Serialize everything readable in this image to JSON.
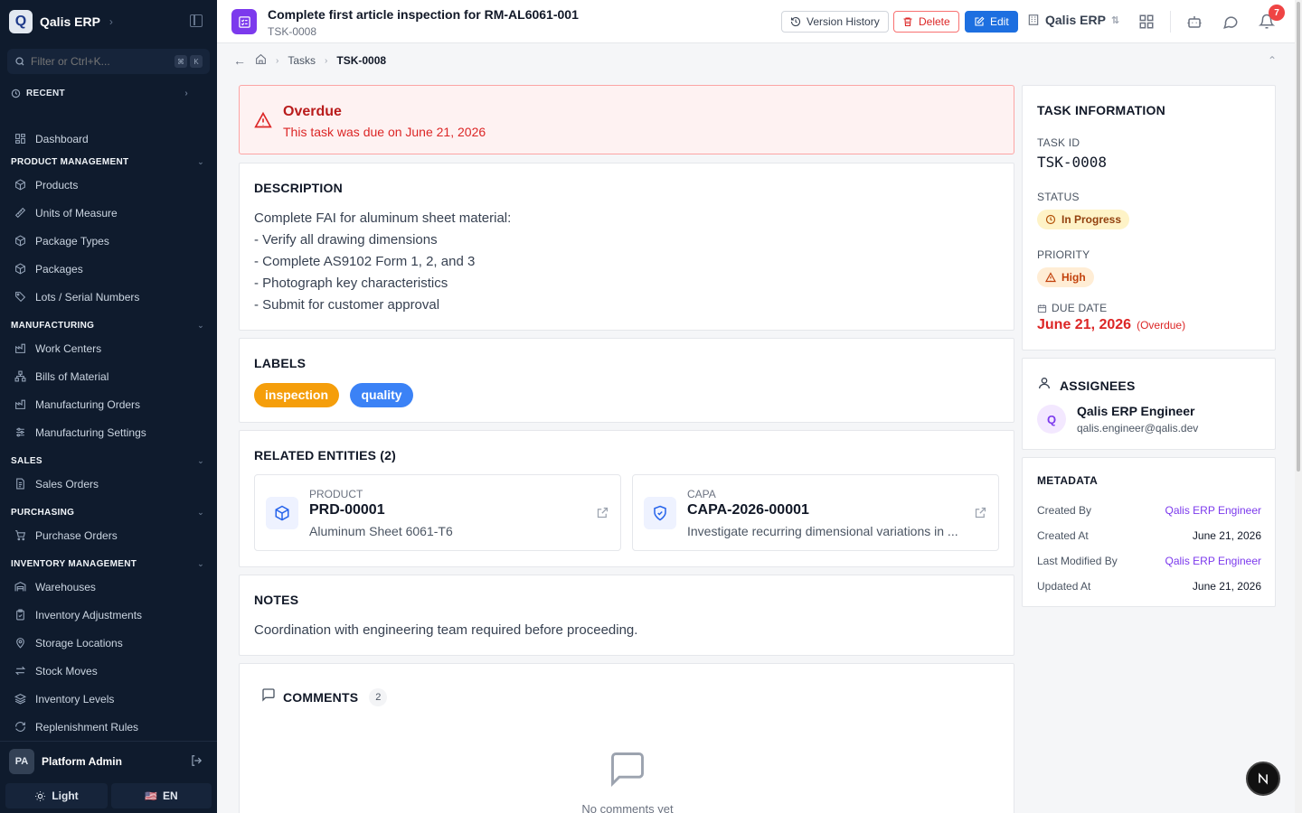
{
  "sidebar": {
    "brand": "Qalis ERP",
    "brand_initial": "Q",
    "filter_placeholder": "Filter or Ctrl+K...",
    "kbd": [
      "⌘",
      "K"
    ],
    "recent_label": "RECENT",
    "top_item": "Dashboard",
    "sections": [
      {
        "title": "PRODUCT MANAGEMENT",
        "items": [
          "Products",
          "Units of Measure",
          "Package Types",
          "Packages",
          "Lots / Serial Numbers"
        ]
      },
      {
        "title": "MANUFACTURING",
        "items": [
          "Work Centers",
          "Bills of Material",
          "Manufacturing Orders",
          "Manufacturing Settings"
        ]
      },
      {
        "title": "SALES",
        "items": [
          "Sales Orders"
        ]
      },
      {
        "title": "PURCHASING",
        "items": [
          "Purchase Orders"
        ]
      },
      {
        "title": "INVENTORY MANAGEMENT",
        "items": [
          "Warehouses",
          "Inventory Adjustments",
          "Storage Locations",
          "Stock Moves",
          "Inventory Levels",
          "Replenishment Rules"
        ]
      }
    ],
    "user": {
      "initials": "PA",
      "name": "Platform Admin"
    },
    "theme_label": "Light",
    "lang_label": "EN",
    "lang_flag": "🇺🇸"
  },
  "header": {
    "title": "Complete first article inspection for RM-AL6061-001",
    "subtitle": "TSK-0008",
    "version_history": "Version History",
    "delete": "Delete",
    "edit": "Edit",
    "tenant": "Qalis ERP",
    "notification_count": "7"
  },
  "breadcrumb": {
    "parent": "Tasks",
    "current": "TSK-0008"
  },
  "alert": {
    "title": "Overdue",
    "text": "This task was due on June 21, 2026"
  },
  "description": {
    "title": "DESCRIPTION",
    "lines": [
      "Complete FAI for aluminum sheet material:",
      "- Verify all drawing dimensions",
      "- Complete AS9102 Form 1, 2, and 3",
      "- Photograph key characteristics",
      "- Submit for customer approval"
    ]
  },
  "labels": {
    "title": "LABELS",
    "items": [
      {
        "text": "inspection",
        "color": "#f59e0b"
      },
      {
        "text": "quality",
        "color": "#3b82f6"
      }
    ]
  },
  "related": {
    "title": "RELATED ENTITIES (2)",
    "items": [
      {
        "type": "PRODUCT",
        "code": "PRD-00001",
        "name": "Aluminum Sheet 6061-T6"
      },
      {
        "type": "CAPA",
        "code": "CAPA-2026-00001",
        "name": "Investigate recurring dimensional variations in ..."
      }
    ]
  },
  "notes": {
    "title": "NOTES",
    "text": "Coordination with engineering team required before proceeding."
  },
  "comments": {
    "title": "COMMENTS",
    "count": "2",
    "empty_text": "No comments yet"
  },
  "task_info": {
    "title": "TASK INFORMATION",
    "id_label": "TASK ID",
    "id_value": "TSK-0008",
    "status_label": "STATUS",
    "status_value": "In Progress",
    "priority_label": "PRIORITY",
    "priority_value": "High",
    "due_label": "DUE DATE",
    "due_value": "June 21, 2026",
    "due_note": "(Overdue)"
  },
  "assignees": {
    "title": "ASSIGNEES",
    "items": [
      {
        "initial": "Q",
        "name": "Qalis ERP Engineer",
        "email": "qalis.engineer@qalis.dev"
      }
    ]
  },
  "metadata": {
    "title": "METADATA",
    "rows": [
      {
        "key": "Created By",
        "value": "Qalis ERP Engineer"
      },
      {
        "key": "Created At",
        "value": "June 21, 2026"
      },
      {
        "key": "Last Modified By",
        "value": "Qalis ERP Engineer"
      },
      {
        "key": "Updated At",
        "value": "June 21, 2026"
      }
    ]
  },
  "colors": {
    "sidebar_bg": "#0f1b2d",
    "primary": "#1d6fe0",
    "danger": "#dc2626",
    "accent": "#7c3aed",
    "status_bg": "#fef3c7",
    "priority_bg": "#ffedd5"
  },
  "icons": {
    "task": "list-check-icon",
    "alert": "warning-triangle-icon",
    "comments": "message-square-icon",
    "assignee": "user-icon",
    "product": "box-icon",
    "capa": "shield-check-icon"
  }
}
